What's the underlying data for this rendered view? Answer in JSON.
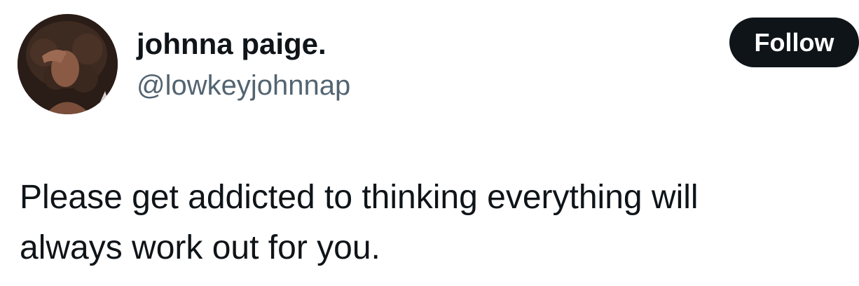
{
  "author": {
    "display_name": "johnna paige.",
    "handle": "@lowkeyjohnnap",
    "avatar_icon": "user-avatar-photo"
  },
  "actions": {
    "follow_label": "Follow"
  },
  "tweet": {
    "text": "Please get addicted to thinking everything will\nalways work out for you."
  },
  "colors": {
    "text_primary": "#0f1419",
    "text_secondary": "#536471",
    "button_bg": "#0f1419",
    "button_text": "#ffffff",
    "background": "#ffffff"
  }
}
